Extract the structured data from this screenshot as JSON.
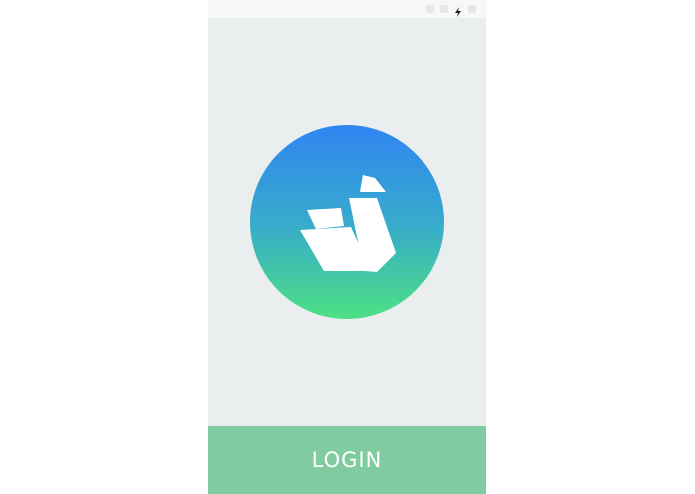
{
  "status_bar": {
    "icons": [
      "signal-icon",
      "wifi-icon",
      "charging-bolt-icon",
      "battery-icon"
    ]
  },
  "logo": {
    "icon": "origami-swan-logo",
    "gradient_top": "#3085f3",
    "gradient_bottom": "#4ee084"
  },
  "login_button": {
    "label": "LOGIN",
    "background": "#80cba0"
  }
}
